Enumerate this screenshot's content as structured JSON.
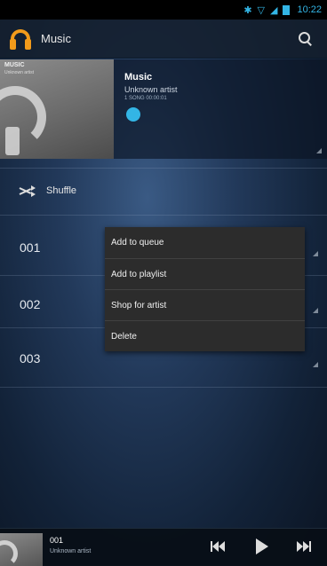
{
  "status_bar": {
    "time": "10:22",
    "icons": [
      "bluetooth-icon",
      "wifi-icon",
      "signal-icon",
      "battery-icon"
    ]
  },
  "action_bar": {
    "title": "Music",
    "app_icon": "headphones-icon",
    "search_icon": "search-icon"
  },
  "album": {
    "art_title": "MUSIC",
    "art_subtitle": "Unknown artist",
    "name": "Music",
    "artist": "Unknown artist",
    "meta": "1 SONG 00:00:01"
  },
  "shuffle": {
    "label": "Shuffle"
  },
  "tracks": [
    {
      "label": "001"
    },
    {
      "label": "002"
    },
    {
      "label": "003"
    }
  ],
  "context_menu": {
    "items": [
      {
        "label": "Add to queue"
      },
      {
        "label": "Add to playlist"
      },
      {
        "label": "Shop for artist"
      },
      {
        "label": "Delete"
      }
    ]
  },
  "now_playing": {
    "title": "001",
    "artist": "Unknown artist",
    "controls": [
      "previous-icon",
      "play-icon",
      "next-icon"
    ]
  },
  "colors": {
    "accent": "#33b5e5",
    "icon_orange": "#f29b1b",
    "menu_bg": "#2c2c2c"
  }
}
